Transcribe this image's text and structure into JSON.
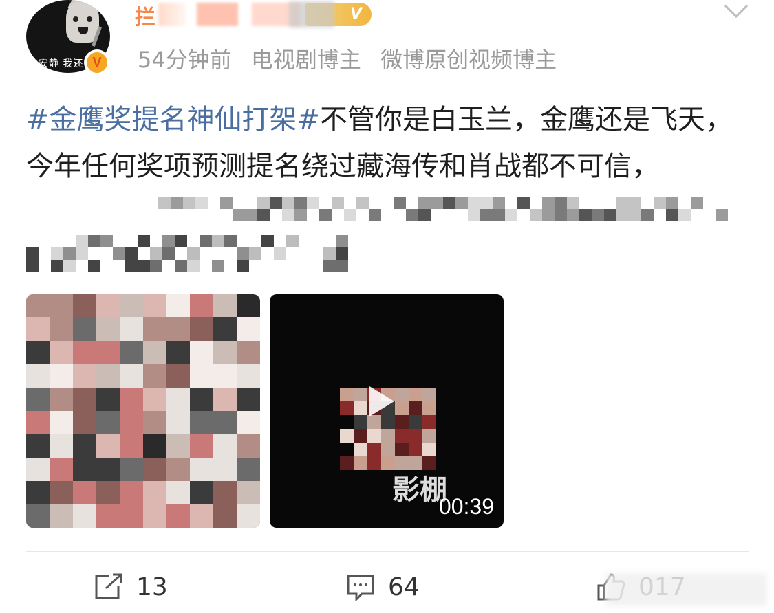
{
  "header": {
    "username": "拦",
    "time": "54分钟前",
    "tags": [
      "电视剧博主",
      "微博原创视频博主"
    ],
    "level_badge": "V",
    "avatar_caption": "安静 我还",
    "verified_badge": "V"
  },
  "post": {
    "hashtag": "#金鹰奖提名神仙打架#",
    "text": "不管你是白玉兰，金鹰还是飞天，今年任何奖项预测提名绕过藏海传和肖战都不可信，"
  },
  "media": [
    {
      "type": "image"
    },
    {
      "type": "video",
      "duration": "00:39",
      "overlay_text": "影棚"
    }
  ],
  "actions": {
    "repost_count": "13",
    "comment_count": "64",
    "like_count": "017"
  },
  "colors": {
    "hashtag": "#4a6ea0",
    "meta": "#9a9a9a",
    "badge": "#f0b640"
  }
}
